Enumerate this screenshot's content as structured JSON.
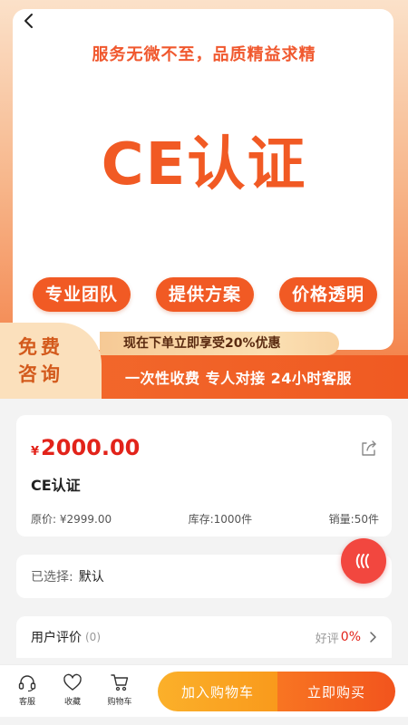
{
  "banner": {
    "slogan": "服务无微不至，品质精益求精",
    "title": "CE认证",
    "pills": [
      "专业团队",
      "提供方案",
      "价格透明"
    ],
    "offer": "现在下单立即享受20%优惠",
    "badge_line1": "免费",
    "badge_line2": "咨询",
    "bottom_text": "一次性收费 专人对接 24小时客服"
  },
  "product": {
    "currency": "¥",
    "price": "2000.00",
    "name": "CE认证",
    "original_price_label": "原价: ¥2999.00",
    "stock_label": "库存:1000件",
    "sales_label": "销量:50件"
  },
  "selection": {
    "label": "已选择:",
    "value": "默认"
  },
  "reviews": {
    "title": "用户评价",
    "count": "(0)",
    "good_label": "好评",
    "good_value": "0%"
  },
  "tabs": {
    "service": "客服",
    "favorite": "收藏",
    "cart": "购物车"
  },
  "actions": {
    "add_to_cart": "加入购物车",
    "buy_now": "立即购买"
  },
  "icons": {
    "back": "chevron-left-icon",
    "share": "share-icon",
    "float": "service-wave-icon",
    "headset": "headset-icon",
    "heart": "heart-icon",
    "cart": "cart-icon"
  },
  "colors": {
    "accent": "#f15a24",
    "price": "#e2231a",
    "cart_button": "#fbb02a",
    "buy_button": "#f2541d"
  }
}
